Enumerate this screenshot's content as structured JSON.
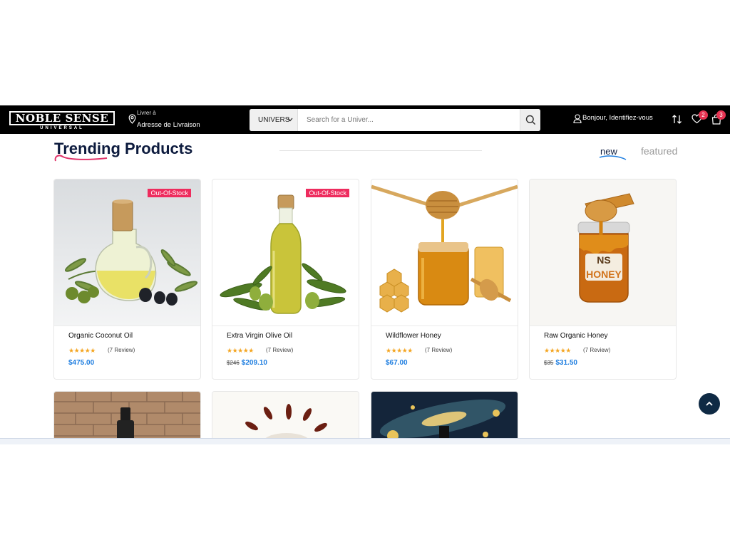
{
  "header": {
    "logo_main": "NOBLE SENSE",
    "logo_sub": "UNIVERSAL",
    "deliver_line1": "Livrer à",
    "deliver_line2": "Adresse de Livraison",
    "search_category": "UNIVERS",
    "search_placeholder": "Search for a Univer...",
    "signin_label": "Bonjour, Identifiez-vous",
    "wishlist_count": "2",
    "cart_count": "3"
  },
  "section": {
    "title": "Trending Products",
    "tab_new": "new",
    "tab_featured": "featured"
  },
  "products": [
    {
      "name": "Organic Coconut Oil",
      "stars": "★★★★★",
      "rating": 4.5,
      "reviews": "(7 Review)",
      "old_price": "",
      "price": "$475.00",
      "badge": "Out-Of-Stock"
    },
    {
      "name": "Extra Virgin Olive Oil",
      "stars": "★★★★★",
      "rating": 4.5,
      "reviews": "(7 Review)",
      "old_price": "$246",
      "price": "$209.10",
      "badge": "Out-Of-Stock"
    },
    {
      "name": "Wildflower Honey",
      "stars": "★★★★★",
      "rating": 4.5,
      "reviews": "(7 Review)",
      "old_price": "",
      "price": "$67.00",
      "badge": ""
    },
    {
      "name": "Raw Organic Honey",
      "stars": "★★★★★",
      "rating": 4.5,
      "reviews": "(7 Review)",
      "old_price": "$35",
      "price": "$31.50",
      "badge": ""
    }
  ],
  "honey_jar_label": "HONEY",
  "honey_jar_logo": "NS",
  "colors": {
    "accent": "#1f7ee0",
    "badge": "#ee2c5e",
    "star": "#f4a623",
    "title": "#0d1b3e"
  }
}
